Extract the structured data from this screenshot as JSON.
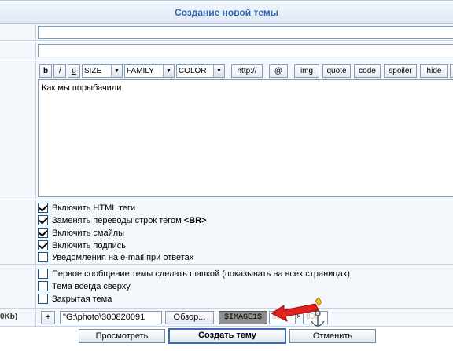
{
  "header": {
    "title": "Создание новой темы"
  },
  "toolbar": {
    "bold": "b",
    "italic": "i",
    "underline": "u",
    "size": "SIZE",
    "family": "FAMILY",
    "color": "COLOR",
    "http": "http://",
    "at": "@",
    "img": "img",
    "quote": "quote",
    "code": "code",
    "spoiler": "spoiler",
    "hide": "hide"
  },
  "editor": {
    "text": "Как мы порыбачили"
  },
  "options": {
    "html": {
      "label": "Включить HTML теги",
      "checked": true
    },
    "br_prefix": "Заменять переводы строк тегом ",
    "br_tag": "<BR>",
    "smileys": {
      "label": "Включить смайлы",
      "checked": true
    },
    "signature": {
      "label": "Включить подпись",
      "checked": true
    },
    "email": {
      "label": "Уведомления на e-mail при ответах",
      "checked": false
    }
  },
  "topic_options": {
    "header": {
      "label": "Первое сообщение темы сделать шапкой (показывать на всех страницах)",
      "checked": false
    },
    "sticky": {
      "label": "Тема всегда сверху",
      "checked": false
    },
    "closed": {
      "label": "Закрытая тема",
      "checked": false
    }
  },
  "attachment": {
    "left_label": "0Kb)",
    "add": "+",
    "file_path": "\"G:\\photo\\300820091",
    "browse": "Обзор...",
    "tag": "$IMAGE1$",
    "width": "800",
    "times": "×",
    "height": "800"
  },
  "actions": {
    "preview": "Просмотреть",
    "create": "Создать тему",
    "cancel": "Отменить"
  }
}
